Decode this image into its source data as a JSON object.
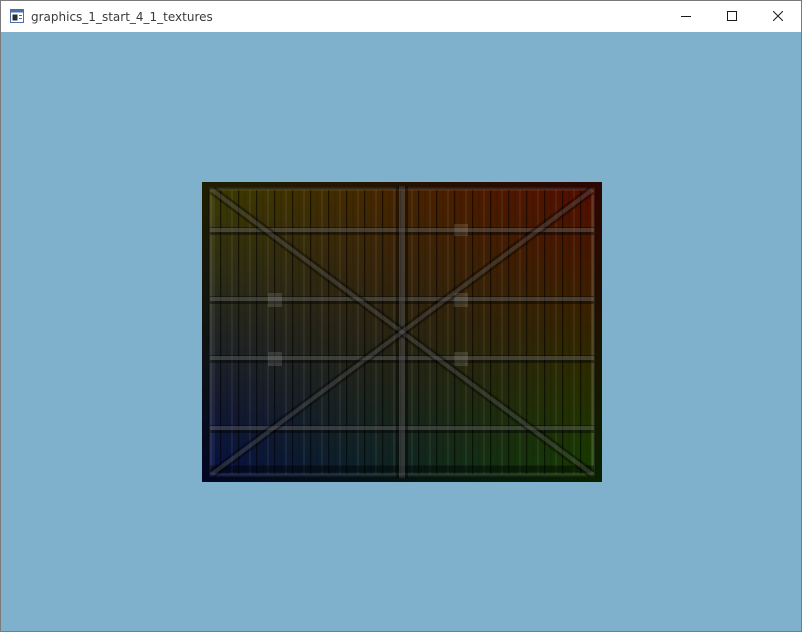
{
  "window": {
    "title": "graphics_1_start_4_1_textures",
    "controls": {
      "minimize_icon": "minimize-icon",
      "maximize_icon": "maximize-icon",
      "close_icon": "close-icon"
    }
  },
  "viewport": {
    "clear_color": "#7fb1cc",
    "quad": {
      "texture": "wooden-container",
      "corner_colors": {
        "top_left": "#8a8a00",
        "top_right": "#c21a00",
        "bottom_left": "#0a1fa0",
        "bottom_right": "#2f8f00"
      }
    }
  }
}
